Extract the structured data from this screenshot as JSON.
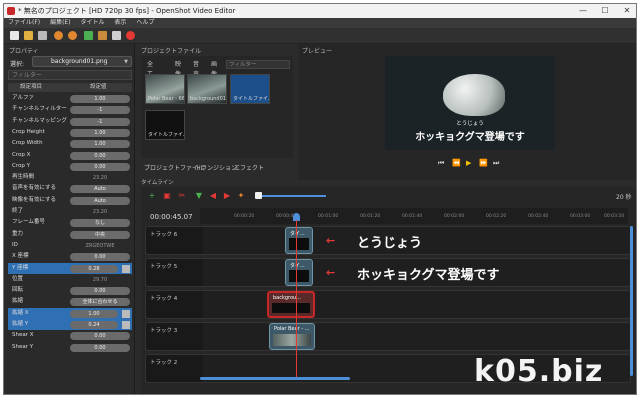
{
  "window": {
    "title": "* 無名のプロジェクト [HD 720p 30 fps] - OpenShot Video Editor",
    "controls": {
      "minimize": "—",
      "maximize": "☐",
      "close": "✕"
    }
  },
  "menu": [
    "ファイル(F)",
    "編集(E)",
    "タイトル",
    "表示",
    "ヘルプ"
  ],
  "toolbar": {
    "icons": [
      "new-project-icon",
      "open-project-icon",
      "save-project-icon",
      "undo-icon",
      "redo-icon",
      "import-files-icon",
      "choose-profile-icon",
      "fullscreen-icon",
      "export-video-icon"
    ]
  },
  "properties": {
    "panel_title": "プロパティ",
    "select_label": "選択:",
    "selected_item": "background01.png",
    "filter_placeholder": "フィルター",
    "col_name": "設定項目",
    "col_value": "設定値",
    "rows": [
      {
        "name": "アルファ",
        "value": "1.00"
      },
      {
        "name": "チャンネルフィルター",
        "value": "-1"
      },
      {
        "name": "チャンネルマッピング",
        "value": "-1"
      },
      {
        "name": "Crop Height",
        "value": "1.00"
      },
      {
        "name": "Crop Width",
        "value": "1.00"
      },
      {
        "name": "Crop X",
        "value": "0.00"
      },
      {
        "name": "Crop Y",
        "value": "0.00"
      },
      {
        "name": "再生時間",
        "value": "23.20"
      },
      {
        "name": "音声を有効にする",
        "value": "Auto"
      },
      {
        "name": "映像を有効にする",
        "value": "Auto"
      },
      {
        "name": "終了",
        "value": "23.20"
      },
      {
        "name": "フレーム番号",
        "value": "なし"
      },
      {
        "name": "重力",
        "value": "中央"
      },
      {
        "name": "ID",
        "value": "ZRGEOTWE"
      },
      {
        "name": "X 座標",
        "value": "0.00"
      },
      {
        "name": "Y 座標",
        "value": "0.28"
      },
      {
        "name": "位置",
        "value": "29.70"
      },
      {
        "name": "回転",
        "value": "0.00"
      },
      {
        "name": "拡縮",
        "value": "全体に合わせる"
      },
      {
        "name": "拡縮 X",
        "value": "1.00"
      },
      {
        "name": "拡縮 Y",
        "value": "0.24"
      },
      {
        "name": "Shear X",
        "value": "0.00"
      },
      {
        "name": "Shear Y",
        "value": "0.00"
      }
    ]
  },
  "project_files": {
    "panel_title": "プロジェクトファイル",
    "tabs": [
      "全て表示",
      "映像",
      "音声",
      "画像"
    ],
    "filter_placeholder": "フィルター",
    "files": [
      {
        "name": "Polar Bear - 664..."
      },
      {
        "name": "background01.p..."
      },
      {
        "name": "タイトルファイル名..."
      },
      {
        "name": "タイトルファイル名..."
      }
    ]
  },
  "preview": {
    "panel_title": "プレビュー",
    "subtitle_small": "とうじょう",
    "subtitle_main": "ホッキョクグマ登場です",
    "controls": [
      "⏮",
      "⏪",
      "▶",
      "⏩",
      "⏭"
    ]
  },
  "bottom_tabs": [
    "プロジェクトファイル",
    "トランジション",
    "エフェクト"
  ],
  "timeline": {
    "title": "タイムライン",
    "timecode": "00:00:45.07",
    "zoom_label": "20 秒",
    "ruler_ticks": [
      "00:00:20",
      "00:00:40",
      "00:01:00",
      "00:01:20",
      "00:01:40",
      "00:02:00",
      "00:02:20",
      "00:02:40",
      "00:03:00",
      "00:03:20"
    ],
    "tracks": [
      {
        "name": "トラック 6",
        "clip": "タイ..."
      },
      {
        "name": "トラック 5",
        "clip": "タイ..."
      },
      {
        "name": "トラック 4",
        "clip": "backgrou..."
      },
      {
        "name": "トラック 3",
        "clip": "Polar Bear - ..."
      },
      {
        "name": "トラック 2",
        "clip": ""
      }
    ]
  },
  "annotations": {
    "arrow": "←",
    "label1": "とうじょう",
    "label2": "ホッキョクグマ登場です"
  },
  "watermark": "k05.biz",
  "colors": {
    "accent": "#4d8fd9",
    "playhead": "#e53935",
    "selected_clip": "#c62828"
  }
}
